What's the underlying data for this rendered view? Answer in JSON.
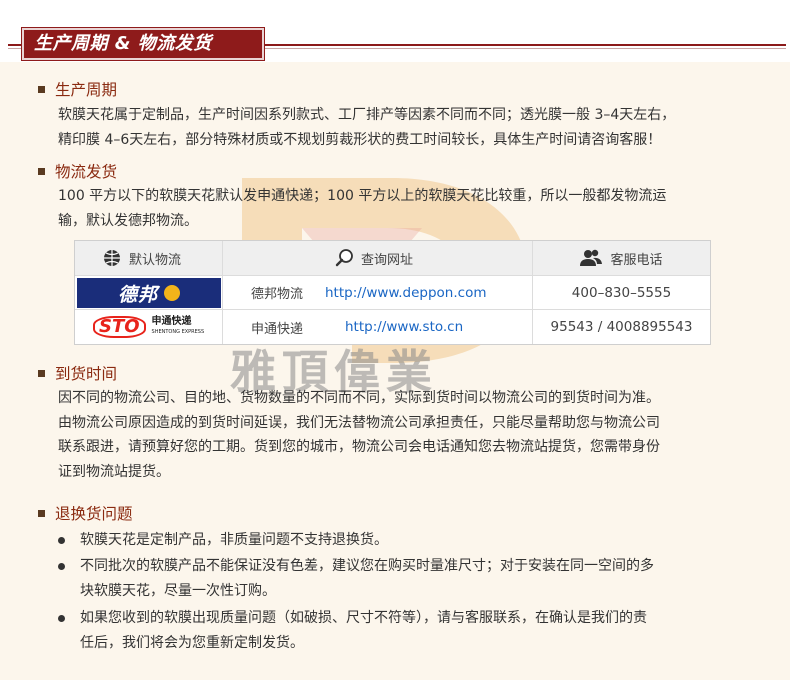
{
  "header": {
    "title": "生产周期 & 物流发货"
  },
  "watermark_text": "雅頂偉業",
  "sections": {
    "production": {
      "title": "生产周期",
      "lines": [
        "软膜天花属于定制品，生产时间因系列款式、工厂排产等因素不同而不同；透光膜一般 3–4天左右，",
        "精印膜 4–6天左右，部分特殊材质或不规划剪裁形状的费工时间较长，具体生产时间请咨询客服！"
      ]
    },
    "shipping": {
      "title": "物流发货",
      "lines": [
        "100 平方以下的软膜天花默认发申通快递；100 平方以上的软膜天花比较重，所以一般都发物流运",
        "输，默认发德邦物流。"
      ]
    },
    "arrival": {
      "title": "到货时间",
      "lines": [
        "因不同的物流公司、目的地、货物数量的不同而不同，实际到货时间以物流公司的到货时间为准。",
        "由物流公司原因造成的到货时间延误，我们无法替物流公司承担责任，只能尽量帮助您与物流公司",
        "联系跟进，请预算好您的工期。货到您的城市，物流公司会电话通知您去物流站提货，您需带身份",
        "证到物流站提货。"
      ]
    },
    "returns": {
      "title": "退换货问题",
      "items": [
        {
          "lines": [
            "软膜天花是定制产品，非质量问题不支持退换货。"
          ]
        },
        {
          "lines": [
            "不同批次的软膜产品不能保证没有色差，建议您在购买时量准尺寸；对于安装在同一空间的多",
            "块软膜天花，尽量一次性订购。"
          ]
        },
        {
          "lines": [
            "如果您收到的软膜出现质量问题（如破损、尺寸不符等），请与客服联系，在确认是我们的责",
            "任后，我们将会为您重新定制发货。"
          ]
        }
      ]
    }
  },
  "logistics_table": {
    "headers": {
      "default_logistics": "默认物流",
      "query_url": "查询网址",
      "service_phone": "客服电话"
    },
    "rows": [
      {
        "logo_text": "德邦",
        "name": "德邦物流",
        "url": "http://www.deppon.com",
        "phone": "400–830–5555"
      },
      {
        "logo_text": "STO",
        "logo_sub": "申通快递",
        "logo_sub_en": "SHENTONG EXPRESS",
        "name": "申通快递",
        "url": "http://www.sto.cn",
        "phone": "95543 / 4008895543"
      }
    ]
  },
  "colors": {
    "header_red": "#8e1b1b",
    "section_title": "#8a2a10",
    "link_blue": "#1a66c4",
    "deppon_blue": "#1a2d7a",
    "sto_red": "#e8231b"
  }
}
